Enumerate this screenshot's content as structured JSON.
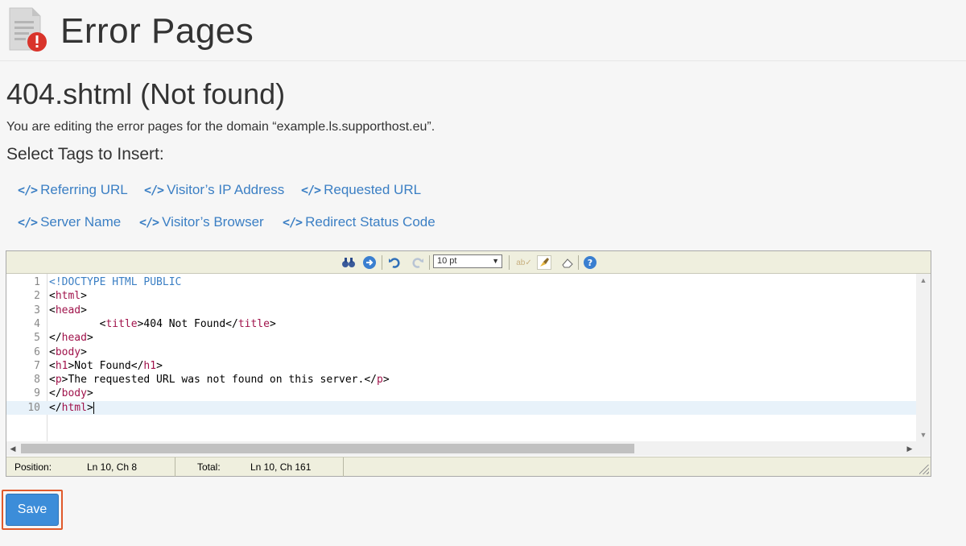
{
  "header": {
    "title": "Error Pages",
    "icon": "document-error-icon"
  },
  "page": {
    "file_title": "404.shtml (Not found)",
    "domain_line": "You are editing the error pages for the domain “example.ls.supporthost.eu”.",
    "select_tags_label": "Select Tags to Insert:"
  },
  "tags": [
    {
      "label": "Referring URL",
      "icon": "code-icon"
    },
    {
      "label": "Visitor’s IP Address",
      "icon": "code-icon"
    },
    {
      "label": "Requested URL",
      "icon": "code-icon"
    },
    {
      "label": "Server Name",
      "icon": "code-icon"
    },
    {
      "label": "Visitor’s Browser",
      "icon": "code-icon"
    },
    {
      "label": "Redirect Status Code",
      "icon": "code-icon"
    }
  ],
  "toolbar": {
    "font_size": "10 pt",
    "icons": [
      "search-replace-icon",
      "goto-line-icon",
      "undo-icon",
      "redo-icon",
      "spellcheck-icon",
      "highlight-icon",
      "reset-icon",
      "help-icon"
    ]
  },
  "editor": {
    "lines": [
      {
        "n": "1",
        "text": "<!DOCTYPE HTML PUBLIC"
      },
      {
        "n": "2",
        "text": "<html>"
      },
      {
        "n": "3",
        "text": "<head>"
      },
      {
        "n": "4",
        "text": "        <title>404 Not Found</title>"
      },
      {
        "n": "5",
        "text": "</head>"
      },
      {
        "n": "6",
        "text": "<body>"
      },
      {
        "n": "7",
        "text": "<h1>Not Found</h1>"
      },
      {
        "n": "8",
        "text": "<p>The requested URL was not found on this server.</p>"
      },
      {
        "n": "9",
        "text": "</body>"
      },
      {
        "n": "10",
        "text": "</html>"
      }
    ],
    "active_line": 10
  },
  "status": {
    "position_label": "Position:",
    "position_value": "Ln 10, Ch 8",
    "total_label": "Total:",
    "total_value": "Ln 10, Ch 161"
  },
  "actions": {
    "save_label": "Save"
  },
  "colors": {
    "accent": "#3c8dd9",
    "link": "#3b7fc4",
    "highlight": "#e05a2b",
    "tag": "#a0134b"
  }
}
